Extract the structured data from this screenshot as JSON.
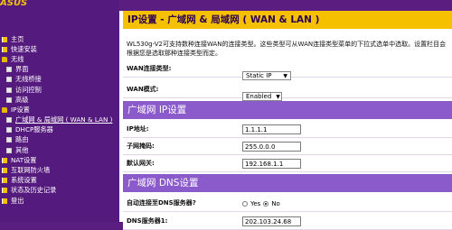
{
  "sidebar": {
    "logo_text": "ASUS",
    "items": [
      {
        "label": "主页",
        "icon": "book-icon",
        "level": 1
      },
      {
        "label": "快速安装",
        "icon": "book-icon",
        "level": 1
      },
      {
        "label": "无线",
        "icon": "folder-icon",
        "level": 1
      },
      {
        "label": "界面",
        "icon": "doc-icon",
        "level": 2
      },
      {
        "label": "无线桥接",
        "icon": "doc-icon",
        "level": 2
      },
      {
        "label": "访问控制",
        "icon": "doc-icon",
        "level": 2
      },
      {
        "label": "高级",
        "icon": "doc-icon",
        "level": 2
      },
      {
        "label": "IP设置",
        "icon": "folder-icon",
        "level": 1
      },
      {
        "label": "广域网 & 局域网 ( WAN & LAN )",
        "icon": "doc-icon",
        "level": 2,
        "selected": true
      },
      {
        "label": "DHCP服务器",
        "icon": "doc-icon",
        "level": 2
      },
      {
        "label": "路由",
        "icon": "doc-icon",
        "level": 2
      },
      {
        "label": "其他",
        "icon": "doc-icon",
        "level": 2
      },
      {
        "label": "NAT设置",
        "icon": "book-icon",
        "level": 1
      },
      {
        "label": "互联网防火墙",
        "icon": "book-icon",
        "level": 1
      },
      {
        "label": "系统设置",
        "icon": "book-icon",
        "level": 1
      },
      {
        "label": "状态及历史记录",
        "icon": "book-icon",
        "level": 1
      },
      {
        "label": "登出",
        "icon": "book-icon",
        "level": 1
      }
    ]
  },
  "main": {
    "title": "IP设置 - 广域网 & 局域网 ( WAN & LAN )",
    "description": "WL530g-V2可支持数种连接WAN的连接类型。这些类型可从WAN连接类型菜单的下拉式选单中选取。设置栏目会根据您是选取那种连接类型而定。",
    "wan_type": {
      "label": "WAN连接类型:",
      "value": "Static IP"
    },
    "wan_mode": {
      "label": "WAN模式:",
      "value": "Enabled"
    },
    "ip_section": "广域网 IP设置",
    "ip_address": {
      "label": "IP地址:",
      "value": "1.1.1.1"
    },
    "subnet_mask": {
      "label": "子网掩码:",
      "value": "255.0.0.0"
    },
    "gateway": {
      "label": "默认网关:",
      "value": "192.168.1.1"
    },
    "dns_section": "广域网 DNS设置",
    "dns_auto": {
      "label": "自动连接至DNS服务器?",
      "options": [
        "Yes",
        "No"
      ],
      "selected": "No"
    },
    "dns_server1": {
      "label": "DNS服务器1:",
      "value": "202.103.24.68"
    }
  },
  "colors": {
    "sidebar_bg": "#551a7d",
    "title_bg": "#f5c000",
    "section_bg": "#8b5acb"
  }
}
